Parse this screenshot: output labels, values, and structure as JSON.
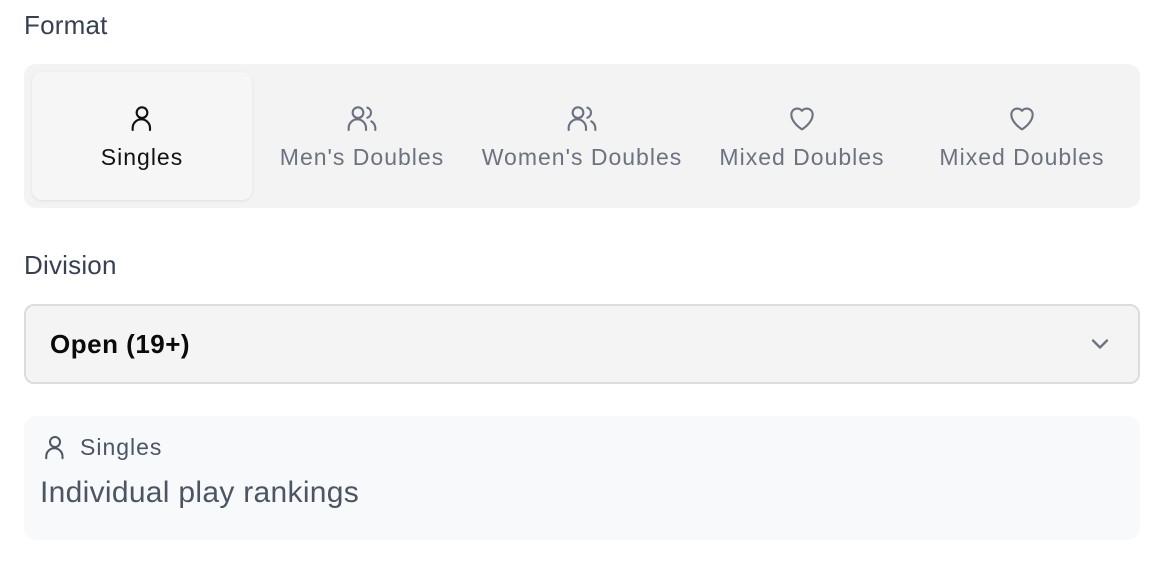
{
  "format": {
    "label": "Format",
    "selected": "Singles",
    "options": [
      {
        "label": "Singles",
        "icon": "user-icon",
        "active": true
      },
      {
        "label": "Men's Doubles",
        "icon": "users-icon",
        "active": false
      },
      {
        "label": "Women's Doubles",
        "icon": "users-icon",
        "active": false
      },
      {
        "label": "Mixed Doubles",
        "icon": "heart-icon",
        "active": false
      },
      {
        "label": "Mixed Doubles",
        "icon": "heart-icon",
        "active": false
      }
    ]
  },
  "division": {
    "label": "Division",
    "value": "Open (19+)",
    "icon": "chevron-down-icon"
  },
  "info": {
    "icon": "user-icon",
    "title": "Singles",
    "description": "Individual play rankings"
  },
  "colors": {
    "active_text": "#111111",
    "inactive_text": "#6b7280",
    "group_bg": "#f3f3f4"
  }
}
